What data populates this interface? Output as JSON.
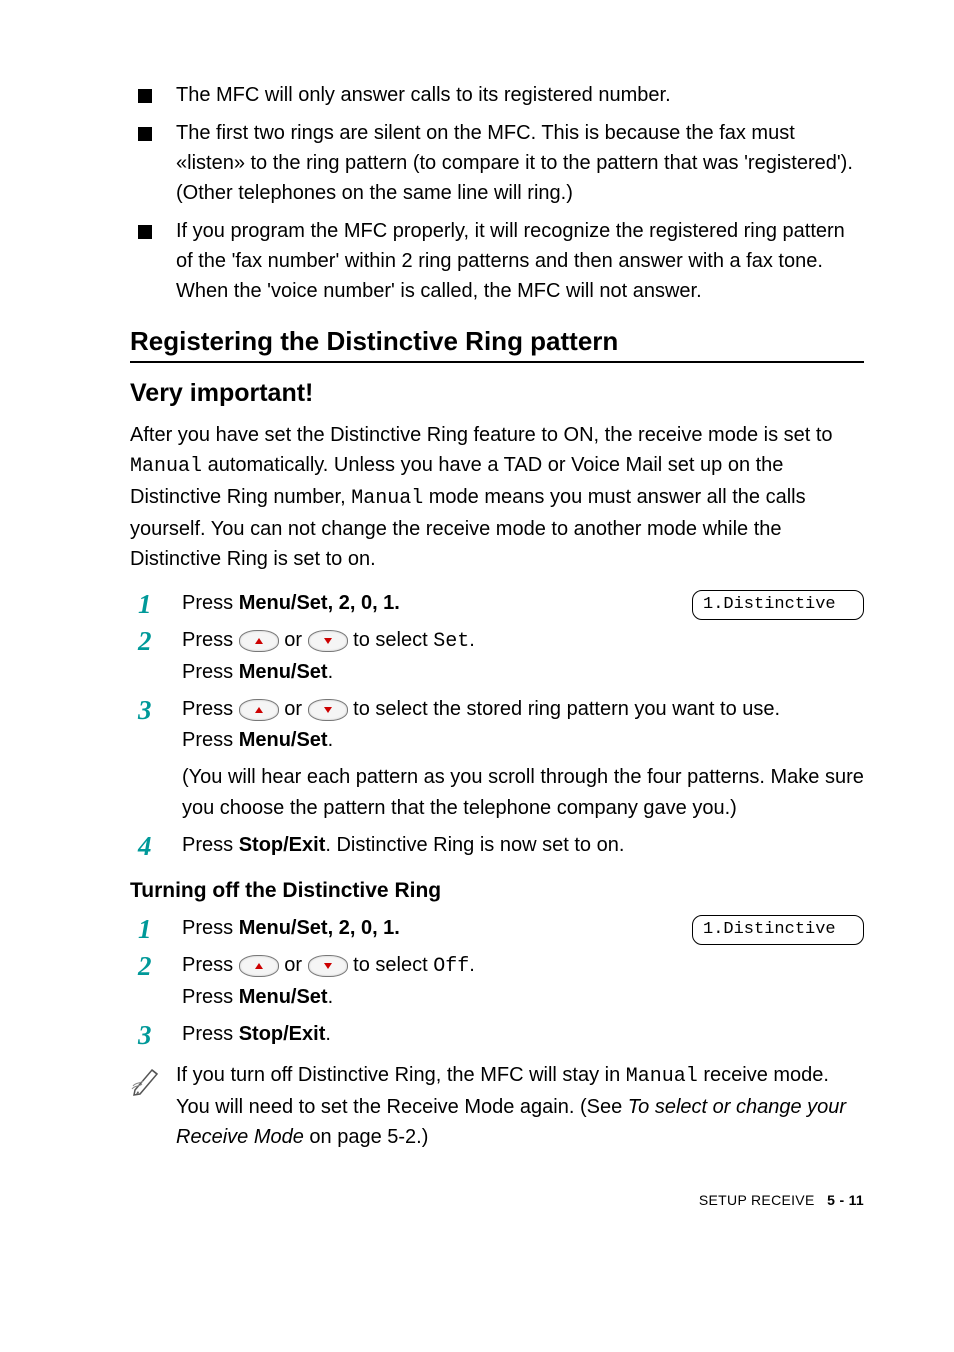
{
  "bullets": [
    "The MFC will only answer calls to its registered number.",
    "The first two rings are silent on the MFC. This is because the fax must «listen» to the ring pattern (to compare it to the pattern that was 'registered'). (Other telephones on the same line will ring.)",
    "If you program the MFC properly, it will recognize the registered ring pattern of the 'fax number' within 2 ring patterns and then answer with a fax tone. When the 'voice number' is called, the MFC will not answer."
  ],
  "heading_register": "Registering the Distinctive Ring pattern",
  "heading_important": "Very important!",
  "intro_p1a": "After you have set the Distinctive Ring feature to ON, the receive mode is set to ",
  "intro_p1_manual": "Manual",
  "intro_p1b": " automatically. Unless you have a TAD or Voice Mail set up on the Distinctive Ring number, ",
  "intro_p1c": " mode means you must answer all the calls yourself. You can not change the receive mode to another mode while the Distinctive Ring is set to on.",
  "lcd1": "1.Distinctive",
  "lcd2": "1.Distinctive",
  "press": "Press ",
  "menu_set": "Menu/Set",
  "stop_exit": "Stop/Exit",
  "seq201": ", 2, 0, 1.",
  "or": " or ",
  "to_select": " to select ",
  "set_code": "Set",
  "off_code": "Off",
  "dot": ".",
  "press_menuset_line": "Press ",
  "ring_pattern_tail": " to select the stored ring pattern you want to use.",
  "hear_pattern": "(You will hear each pattern as you scroll through the four patterns. Make sure you choose the pattern that the telephone company gave you.)",
  "dr_set_on": ". Distinctive Ring is now set to on.",
  "heading_turnoff": "Turning off the Distinctive Ring",
  "note_a": "If you turn off Distinctive Ring, the MFC will stay in ",
  "note_b": " receive mode. You will need to set the Receive Mode again. (See ",
  "note_link": "To select or change your Receive Mode",
  "note_c": " on page 5-2.)",
  "footer_section": "SETUP RECEIVE",
  "footer_page": "5 - 11"
}
